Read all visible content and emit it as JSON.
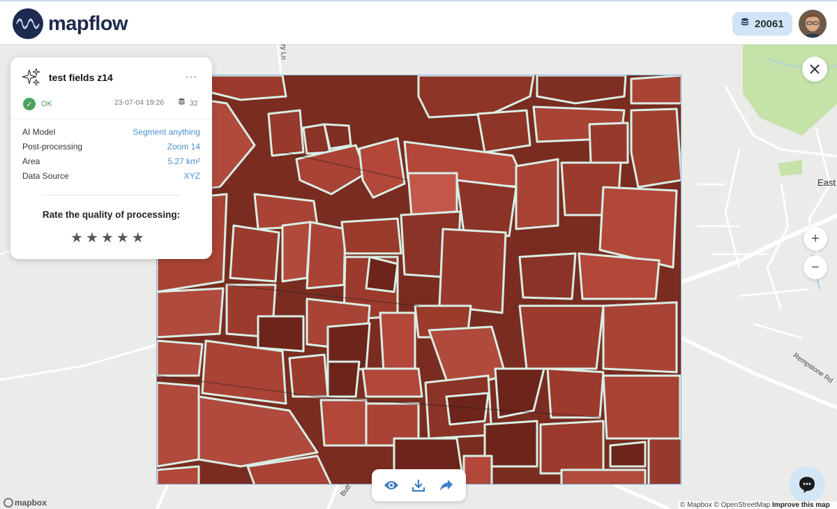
{
  "header": {
    "logo_text": "mapflow",
    "credits": "20061",
    "credits_icon": "coins-icon",
    "avatar": "user-avatar"
  },
  "map": {
    "place_label": "East",
    "road_labels": [
      "Rempstone Rd",
      "Butt",
      "ry Ln"
    ]
  },
  "processing": {
    "title": "test fields z14",
    "menu": "···",
    "status": "OK",
    "date": "23-07-04 19:26",
    "cost": "32",
    "details": [
      {
        "label": "AI Model",
        "value": "Segment anything"
      },
      {
        "label": "Post-processing",
        "value": "Zoom 14"
      },
      {
        "label": "Area",
        "value": "5.27 km²"
      },
      {
        "label": "Data Source",
        "value": "XYZ"
      }
    ],
    "rate_title": "Rate the quality of processing:",
    "rating_max": 5
  },
  "controls": {
    "zoom_in": "+",
    "zoom_out": "−"
  },
  "toolbar": {
    "tools": [
      "eye-icon",
      "download-icon",
      "share-icon"
    ]
  },
  "attribution": {
    "logo": "mapbox",
    "text_1": "© Mapbox © OpenStreetMap",
    "text_2": "Improve this map"
  },
  "colors": {
    "brand": "#1e2a4f",
    "accent": "#4a90d0",
    "ok": "#4ba15f",
    "field_fill": "#b0463a",
    "field_outline": "#d9efe6"
  }
}
